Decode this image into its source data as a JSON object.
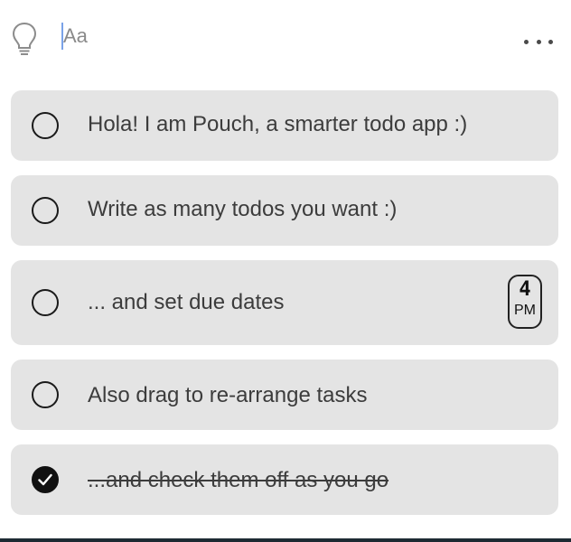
{
  "header": {
    "input_placeholder": "Aa"
  },
  "todos": [
    {
      "text": "Hola! I am Pouch, a smarter todo app :)",
      "done": false
    },
    {
      "text": "Write as many todos you want :)",
      "done": false
    },
    {
      "text": "... and set due dates",
      "done": false,
      "due": {
        "hour": "4",
        "period": "PM"
      }
    },
    {
      "text": "Also drag to re-arrange tasks",
      "done": false
    },
    {
      "text": "...and check them off as you go",
      "done": true
    }
  ],
  "colors": {
    "card_background": "#e4e4e4",
    "caret": "#7aa2e8",
    "text": "#3c3c3c",
    "check": "#111111"
  },
  "icons": {
    "idea": "lightbulb-icon",
    "menu": "more-horizontal-icon",
    "done": "checkmark-icon"
  }
}
